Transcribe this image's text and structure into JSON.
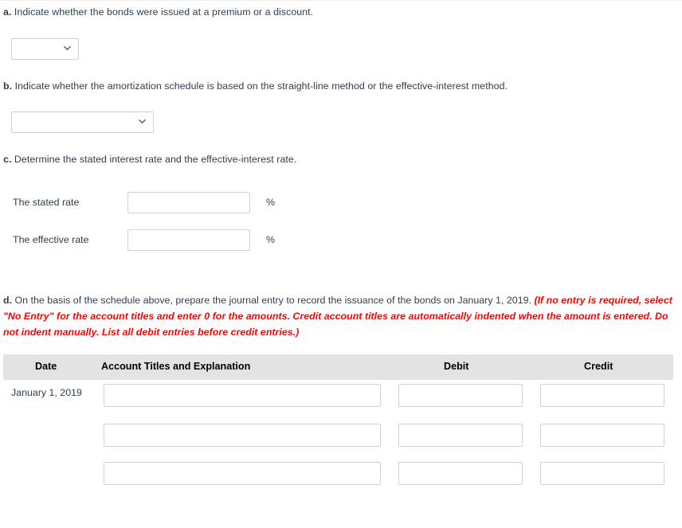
{
  "question": {
    "part_a": {
      "letter": "a.",
      "text": " Indicate whether the bonds were issued at a premium or a discount.",
      "dropdown": {
        "value": "",
        "name": "premium-or-discount-select"
      }
    },
    "part_b": {
      "letter": "b.",
      "text": " Indicate whether the amortization schedule is based on the straight-line method or the effective-interest method.",
      "dropdown": {
        "value": "",
        "name": "amortization-method-select"
      }
    },
    "part_c": {
      "letter": "c.",
      "text": " Determine the stated interest rate and the effective-interest rate.",
      "rows": [
        {
          "label": "The stated rate",
          "value": "",
          "unit": "%"
        },
        {
          "label": "The effective rate",
          "value": "",
          "unit": "%"
        }
      ]
    },
    "part_d": {
      "letter": "d.",
      "text": " On the basis of the schedule above, prepare the journal entry to record the issuance of the bonds on January 1, 2019. ",
      "note": "(If no entry is required, select \"No Entry\" for the account titles and enter 0 for the amounts. Credit account titles are automatically indented when the amount is entered. Do not indent manually. List all debit entries before credit entries.)"
    }
  },
  "journal_table": {
    "columns": [
      "Date",
      "Account Titles and Explanation",
      "Debit",
      "Credit"
    ],
    "rows": [
      {
        "date": "January 1, 2019",
        "account": "",
        "debit": "",
        "credit": ""
      },
      {
        "date": "",
        "account": "",
        "debit": "",
        "credit": ""
      },
      {
        "date": "",
        "account": "",
        "debit": "",
        "credit": ""
      }
    ]
  },
  "icons": {
    "chevron_down": "chevron-down-icon"
  },
  "colors": {
    "text": "#31404f",
    "note_red": "#fe0000",
    "table_header_bg": "#e3e3e3",
    "input_border": "#d2d2d2"
  }
}
